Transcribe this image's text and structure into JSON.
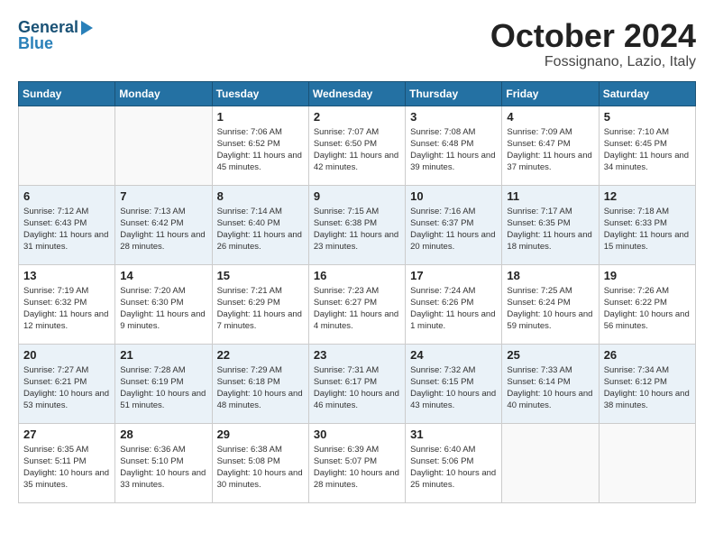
{
  "header": {
    "logo_line1": "General",
    "logo_line2": "Blue",
    "month": "October 2024",
    "location": "Fossignano, Lazio, Italy"
  },
  "days_of_week": [
    "Sunday",
    "Monday",
    "Tuesday",
    "Wednesday",
    "Thursday",
    "Friday",
    "Saturday"
  ],
  "weeks": [
    [
      {
        "day": "",
        "info": ""
      },
      {
        "day": "",
        "info": ""
      },
      {
        "day": "1",
        "info": "Sunrise: 7:06 AM\nSunset: 6:52 PM\nDaylight: 11 hours and 45 minutes."
      },
      {
        "day": "2",
        "info": "Sunrise: 7:07 AM\nSunset: 6:50 PM\nDaylight: 11 hours and 42 minutes."
      },
      {
        "day": "3",
        "info": "Sunrise: 7:08 AM\nSunset: 6:48 PM\nDaylight: 11 hours and 39 minutes."
      },
      {
        "day": "4",
        "info": "Sunrise: 7:09 AM\nSunset: 6:47 PM\nDaylight: 11 hours and 37 minutes."
      },
      {
        "day": "5",
        "info": "Sunrise: 7:10 AM\nSunset: 6:45 PM\nDaylight: 11 hours and 34 minutes."
      }
    ],
    [
      {
        "day": "6",
        "info": "Sunrise: 7:12 AM\nSunset: 6:43 PM\nDaylight: 11 hours and 31 minutes."
      },
      {
        "day": "7",
        "info": "Sunrise: 7:13 AM\nSunset: 6:42 PM\nDaylight: 11 hours and 28 minutes."
      },
      {
        "day": "8",
        "info": "Sunrise: 7:14 AM\nSunset: 6:40 PM\nDaylight: 11 hours and 26 minutes."
      },
      {
        "day": "9",
        "info": "Sunrise: 7:15 AM\nSunset: 6:38 PM\nDaylight: 11 hours and 23 minutes."
      },
      {
        "day": "10",
        "info": "Sunrise: 7:16 AM\nSunset: 6:37 PM\nDaylight: 11 hours and 20 minutes."
      },
      {
        "day": "11",
        "info": "Sunrise: 7:17 AM\nSunset: 6:35 PM\nDaylight: 11 hours and 18 minutes."
      },
      {
        "day": "12",
        "info": "Sunrise: 7:18 AM\nSunset: 6:33 PM\nDaylight: 11 hours and 15 minutes."
      }
    ],
    [
      {
        "day": "13",
        "info": "Sunrise: 7:19 AM\nSunset: 6:32 PM\nDaylight: 11 hours and 12 minutes."
      },
      {
        "day": "14",
        "info": "Sunrise: 7:20 AM\nSunset: 6:30 PM\nDaylight: 11 hours and 9 minutes."
      },
      {
        "day": "15",
        "info": "Sunrise: 7:21 AM\nSunset: 6:29 PM\nDaylight: 11 hours and 7 minutes."
      },
      {
        "day": "16",
        "info": "Sunrise: 7:23 AM\nSunset: 6:27 PM\nDaylight: 11 hours and 4 minutes."
      },
      {
        "day": "17",
        "info": "Sunrise: 7:24 AM\nSunset: 6:26 PM\nDaylight: 11 hours and 1 minute."
      },
      {
        "day": "18",
        "info": "Sunrise: 7:25 AM\nSunset: 6:24 PM\nDaylight: 10 hours and 59 minutes."
      },
      {
        "day": "19",
        "info": "Sunrise: 7:26 AM\nSunset: 6:22 PM\nDaylight: 10 hours and 56 minutes."
      }
    ],
    [
      {
        "day": "20",
        "info": "Sunrise: 7:27 AM\nSunset: 6:21 PM\nDaylight: 10 hours and 53 minutes."
      },
      {
        "day": "21",
        "info": "Sunrise: 7:28 AM\nSunset: 6:19 PM\nDaylight: 10 hours and 51 minutes."
      },
      {
        "day": "22",
        "info": "Sunrise: 7:29 AM\nSunset: 6:18 PM\nDaylight: 10 hours and 48 minutes."
      },
      {
        "day": "23",
        "info": "Sunrise: 7:31 AM\nSunset: 6:17 PM\nDaylight: 10 hours and 46 minutes."
      },
      {
        "day": "24",
        "info": "Sunrise: 7:32 AM\nSunset: 6:15 PM\nDaylight: 10 hours and 43 minutes."
      },
      {
        "day": "25",
        "info": "Sunrise: 7:33 AM\nSunset: 6:14 PM\nDaylight: 10 hours and 40 minutes."
      },
      {
        "day": "26",
        "info": "Sunrise: 7:34 AM\nSunset: 6:12 PM\nDaylight: 10 hours and 38 minutes."
      }
    ],
    [
      {
        "day": "27",
        "info": "Sunrise: 6:35 AM\nSunset: 5:11 PM\nDaylight: 10 hours and 35 minutes."
      },
      {
        "day": "28",
        "info": "Sunrise: 6:36 AM\nSunset: 5:10 PM\nDaylight: 10 hours and 33 minutes."
      },
      {
        "day": "29",
        "info": "Sunrise: 6:38 AM\nSunset: 5:08 PM\nDaylight: 10 hours and 30 minutes."
      },
      {
        "day": "30",
        "info": "Sunrise: 6:39 AM\nSunset: 5:07 PM\nDaylight: 10 hours and 28 minutes."
      },
      {
        "day": "31",
        "info": "Sunrise: 6:40 AM\nSunset: 5:06 PM\nDaylight: 10 hours and 25 minutes."
      },
      {
        "day": "",
        "info": ""
      },
      {
        "day": "",
        "info": ""
      }
    ]
  ]
}
